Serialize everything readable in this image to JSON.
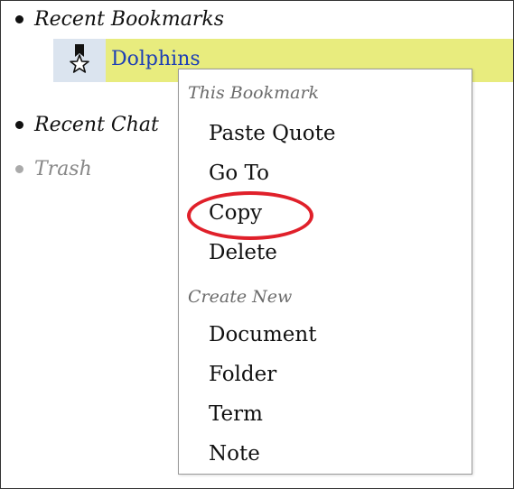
{
  "tree": {
    "recent_bookmarks": "Recent Bookmarks",
    "recent_chats": "Recent Chat",
    "trash": "Trash"
  },
  "bookmark": {
    "label": "Dolphins",
    "icon": "bookmark-star-icon"
  },
  "context_menu": {
    "section_bookmark": "This Bookmark",
    "bookmark_items": [
      "Paste Quote",
      "Go To",
      "Copy",
      "Delete"
    ],
    "section_create": "Create New",
    "create_items": [
      "Document",
      "Folder",
      "Term",
      "Note"
    ]
  },
  "annotation": {
    "circled_item": "Copy",
    "color": "#e0202a"
  },
  "colors": {
    "bookmark_highlight": "#e8ec7e",
    "bookmark_icon_bg": "#dbe4ef",
    "link_blue": "#1d3fb5"
  }
}
